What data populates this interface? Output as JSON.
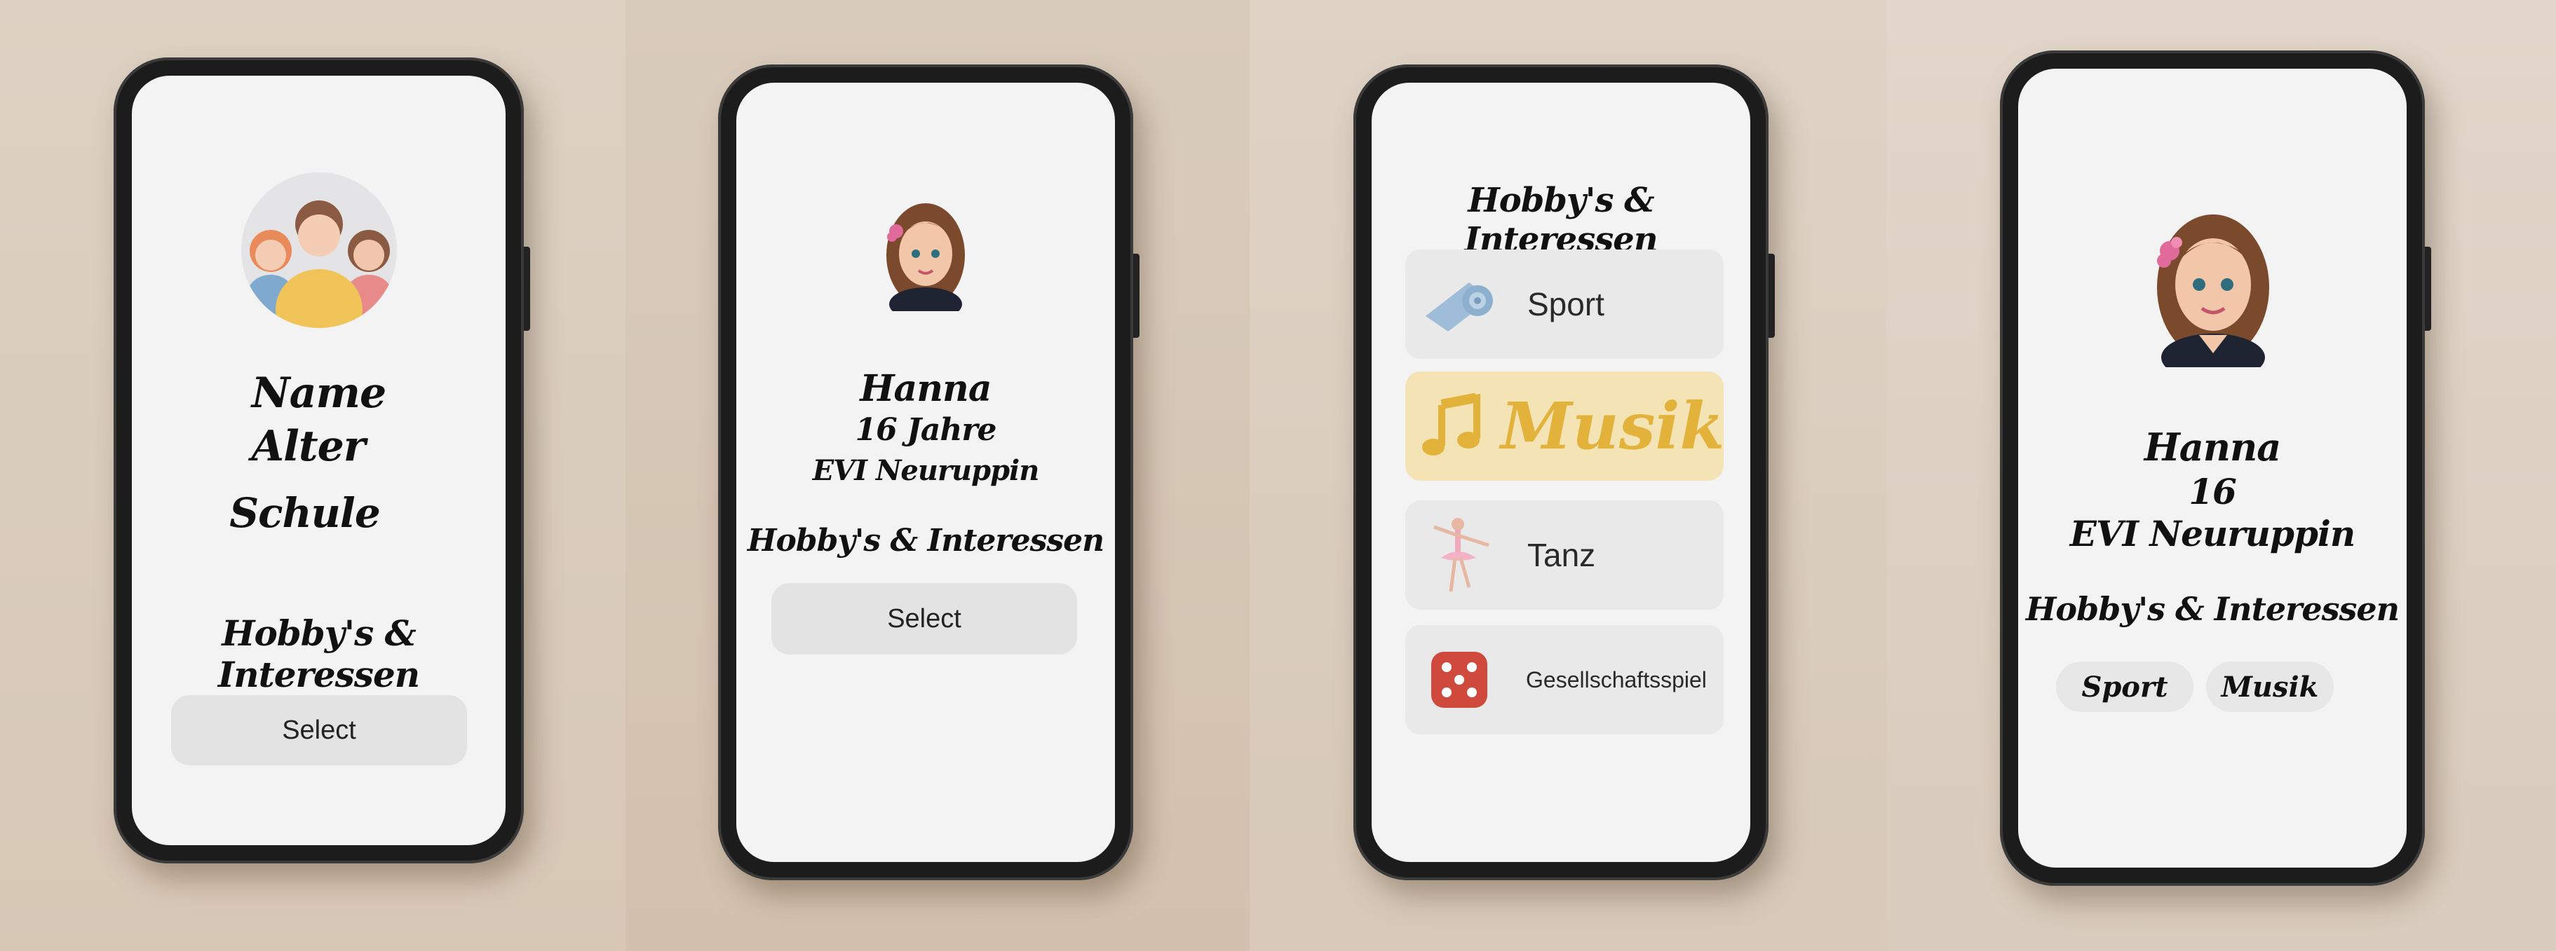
{
  "screen1": {
    "name_label": "Name",
    "age_label": "Alter",
    "school_label": "Schule",
    "hobbies_heading": "Hobby's & Interessen",
    "select_label": "Select",
    "avatar_icon": "family-group-icon"
  },
  "screen2": {
    "name": "Hanna",
    "age": "16 Jahre",
    "school": "EVI Neuruppin",
    "hobbies_heading": "Hobby's & Interessen",
    "select_label": "Select",
    "avatar_icon": "girl-avatar-icon"
  },
  "screen3": {
    "heading": "Hobby's & Interessen",
    "options": [
      {
        "label": "Sport",
        "icon": "yoga-mat-icon",
        "selected": false
      },
      {
        "label": "Musik",
        "icon": "music-note-icon",
        "selected": true
      },
      {
        "label": "Tanz",
        "icon": "ballerina-icon",
        "selected": false
      },
      {
        "label": "Gesellschaftsspiel",
        "icon": "dice-icon",
        "selected": false
      }
    ]
  },
  "screen4": {
    "name": "Hanna",
    "age": "16",
    "school": "EVI Neuruppin",
    "hobbies_heading": "Hobby's & Interessen",
    "chips": [
      "Sport",
      "Musik"
    ],
    "avatar_icon": "girl-avatar-icon"
  },
  "colors": {
    "background": "#d8c9b8",
    "phone_frame": "#1c1c1c",
    "screen": "#f3f3f4",
    "highlight_tile": "#f3e3b5",
    "musik_accent": "#e2b23a"
  }
}
